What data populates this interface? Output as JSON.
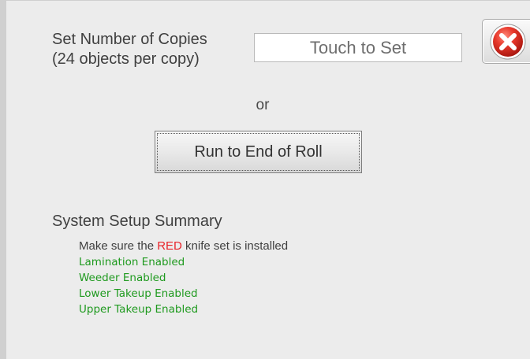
{
  "copies": {
    "label_line1": "Set Number of Copies",
    "label_line2": "(24 objects per copy)",
    "field_text": "Touch to Set"
  },
  "close_button": {
    "icon": "close-icon",
    "color": "#e0342b"
  },
  "or_text": "or",
  "run_button_label": "Run to End of Roll",
  "summary": {
    "title": "System Setup Summary",
    "knife_prefix": "Make sure the ",
    "knife_highlight": "RED",
    "knife_suffix": " knife set is installed",
    "status_items": [
      "Lamination Enabled",
      "Weeder Enabled",
      "Lower Takeup Enabled",
      "Upper Takeup Enabled"
    ]
  },
  "colors": {
    "highlight_red": "#e8242a",
    "status_green": "#1f9a1f"
  }
}
